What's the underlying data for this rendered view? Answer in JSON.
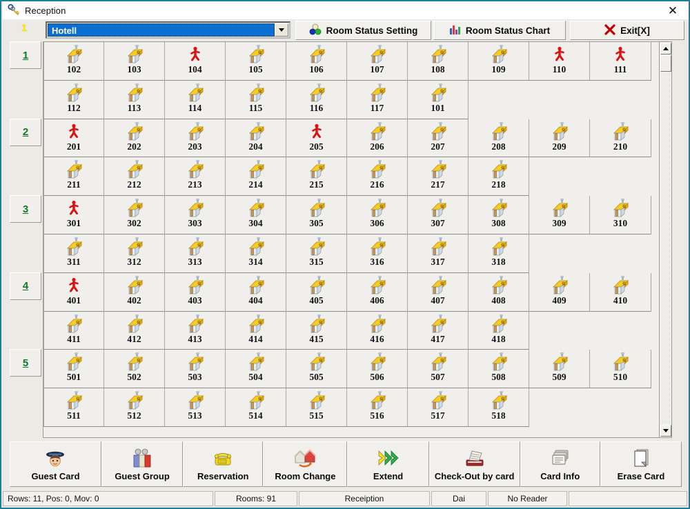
{
  "window": {
    "title": "Reception",
    "title_icon": "keys-icon",
    "close_label": "✕"
  },
  "toolbar": {
    "floor_indicator": "1",
    "combo": {
      "value": "Hotell",
      "arrow_icon": "chevron-down-icon"
    },
    "buttons": [
      {
        "label": "Room Status Setting",
        "icon": "three-circles-icon"
      },
      {
        "label": "Room Status Chart",
        "icon": "bar-chart-icon"
      },
      {
        "label": "Exit[X]",
        "icon": "red-x-icon"
      }
    ]
  },
  "floors": [
    {
      "label": "1"
    },
    {
      "label": "2"
    },
    {
      "label": "3"
    },
    {
      "label": "4"
    },
    {
      "label": "5"
    }
  ],
  "legend": {
    "vacant_icon": "house-icon",
    "occupied_icon": "red-person-icon"
  },
  "grid": {
    "columns": 10,
    "rows": [
      {
        "cells": [
          {
            "room": "102",
            "status": "vacant"
          },
          {
            "room": "103",
            "status": "vacant"
          },
          {
            "room": "104",
            "status": "occupied"
          },
          {
            "room": "105",
            "status": "vacant"
          },
          {
            "room": "106",
            "status": "vacant"
          },
          {
            "room": "107",
            "status": "vacant"
          },
          {
            "room": "108",
            "status": "vacant"
          },
          {
            "room": "109",
            "status": "vacant"
          },
          {
            "room": "110",
            "status": "occupied"
          },
          {
            "room": "111",
            "status": "occupied"
          }
        ]
      },
      {
        "cells": [
          {
            "room": "112",
            "status": "vacant"
          },
          {
            "room": "113",
            "status": "vacant"
          },
          {
            "room": "114",
            "status": "vacant"
          },
          {
            "room": "115",
            "status": "vacant"
          },
          {
            "room": "116",
            "status": "vacant"
          },
          {
            "room": "117",
            "status": "vacant"
          },
          {
            "room": "101",
            "status": "vacant"
          },
          {
            "room": "",
            "status": "empty"
          },
          {
            "room": "",
            "status": "empty"
          },
          {
            "room": "",
            "status": "empty"
          }
        ]
      },
      {
        "cells": [
          {
            "room": "201",
            "status": "occupied"
          },
          {
            "room": "202",
            "status": "vacant"
          },
          {
            "room": "203",
            "status": "vacant"
          },
          {
            "room": "204",
            "status": "vacant"
          },
          {
            "room": "205",
            "status": "occupied"
          },
          {
            "room": "206",
            "status": "vacant"
          },
          {
            "room": "207",
            "status": "vacant"
          },
          {
            "room": "208",
            "status": "vacant"
          },
          {
            "room": "209",
            "status": "vacant"
          },
          {
            "room": "210",
            "status": "vacant"
          }
        ]
      },
      {
        "cells": [
          {
            "room": "211",
            "status": "vacant"
          },
          {
            "room": "212",
            "status": "vacant"
          },
          {
            "room": "213",
            "status": "vacant"
          },
          {
            "room": "214",
            "status": "vacant"
          },
          {
            "room": "215",
            "status": "vacant"
          },
          {
            "room": "216",
            "status": "vacant"
          },
          {
            "room": "217",
            "status": "vacant"
          },
          {
            "room": "218",
            "status": "vacant"
          },
          {
            "room": "",
            "status": "empty"
          },
          {
            "room": "",
            "status": "empty"
          }
        ]
      },
      {
        "cells": [
          {
            "room": "301",
            "status": "occupied"
          },
          {
            "room": "302",
            "status": "vacant"
          },
          {
            "room": "303",
            "status": "vacant"
          },
          {
            "room": "304",
            "status": "vacant"
          },
          {
            "room": "305",
            "status": "vacant"
          },
          {
            "room": "306",
            "status": "vacant"
          },
          {
            "room": "307",
            "status": "vacant"
          },
          {
            "room": "308",
            "status": "vacant"
          },
          {
            "room": "309",
            "status": "vacant"
          },
          {
            "room": "310",
            "status": "vacant"
          }
        ]
      },
      {
        "cells": [
          {
            "room": "311",
            "status": "vacant"
          },
          {
            "room": "312",
            "status": "vacant"
          },
          {
            "room": "313",
            "status": "vacant"
          },
          {
            "room": "314",
            "status": "vacant"
          },
          {
            "room": "315",
            "status": "vacant"
          },
          {
            "room": "316",
            "status": "vacant"
          },
          {
            "room": "317",
            "status": "vacant"
          },
          {
            "room": "318",
            "status": "vacant"
          },
          {
            "room": "",
            "status": "empty"
          },
          {
            "room": "",
            "status": "empty"
          }
        ]
      },
      {
        "cells": [
          {
            "room": "401",
            "status": "occupied"
          },
          {
            "room": "402",
            "status": "vacant"
          },
          {
            "room": "403",
            "status": "vacant"
          },
          {
            "room": "404",
            "status": "vacant"
          },
          {
            "room": "405",
            "status": "vacant"
          },
          {
            "room": "406",
            "status": "vacant"
          },
          {
            "room": "407",
            "status": "vacant"
          },
          {
            "room": "408",
            "status": "vacant"
          },
          {
            "room": "409",
            "status": "vacant"
          },
          {
            "room": "410",
            "status": "vacant"
          }
        ]
      },
      {
        "cells": [
          {
            "room": "411",
            "status": "vacant"
          },
          {
            "room": "412",
            "status": "vacant"
          },
          {
            "room": "413",
            "status": "vacant"
          },
          {
            "room": "414",
            "status": "vacant"
          },
          {
            "room": "415",
            "status": "vacant"
          },
          {
            "room": "416",
            "status": "vacant"
          },
          {
            "room": "417",
            "status": "vacant"
          },
          {
            "room": "418",
            "status": "vacant"
          },
          {
            "room": "",
            "status": "empty"
          },
          {
            "room": "",
            "status": "empty"
          }
        ]
      },
      {
        "cells": [
          {
            "room": "501",
            "status": "vacant"
          },
          {
            "room": "502",
            "status": "vacant"
          },
          {
            "room": "503",
            "status": "vacant"
          },
          {
            "room": "504",
            "status": "vacant"
          },
          {
            "room": "505",
            "status": "vacant"
          },
          {
            "room": "506",
            "status": "vacant"
          },
          {
            "room": "507",
            "status": "vacant"
          },
          {
            "room": "508",
            "status": "vacant"
          },
          {
            "room": "509",
            "status": "vacant"
          },
          {
            "room": "510",
            "status": "vacant"
          }
        ]
      },
      {
        "cells": [
          {
            "room": "511",
            "status": "vacant"
          },
          {
            "room": "512",
            "status": "vacant"
          },
          {
            "room": "513",
            "status": "vacant"
          },
          {
            "room": "514",
            "status": "vacant"
          },
          {
            "room": "515",
            "status": "vacant"
          },
          {
            "room": "516",
            "status": "vacant"
          },
          {
            "room": "517",
            "status": "vacant"
          },
          {
            "room": "518",
            "status": "vacant"
          },
          {
            "room": "",
            "status": "empty"
          },
          {
            "room": "",
            "status": "empty"
          }
        ]
      }
    ]
  },
  "scrollbar": {
    "up_icon": "triangle-up-icon",
    "down_icon": "triangle-down-icon"
  },
  "actions": [
    {
      "label": "Guest Card",
      "icon": "guest-card-icon",
      "width": 135
    },
    {
      "label": "Guest Group",
      "icon": "guest-group-icon",
      "width": 120
    },
    {
      "label": "Reservation",
      "icon": "telephone-icon",
      "width": 118
    },
    {
      "label": "Room Change",
      "icon": "room-change-icon",
      "width": 124
    },
    {
      "label": "Extend",
      "icon": "extend-arrows-icon",
      "width": 120
    },
    {
      "label": "Check-Out by card",
      "icon": "card-reader-icon",
      "width": 134
    },
    {
      "label": "Card Info",
      "icon": "card-stack-icon",
      "width": 118
    },
    {
      "label": "Erase Card",
      "icon": "blank-card-icon",
      "width": 120
    }
  ],
  "statusbar": {
    "rows_info": "Rows: 11, Pos: 0, Mov: 0",
    "rooms": "Rooms:  91",
    "mode": "Receiption",
    "user": "Dai",
    "reader": "No Reader"
  },
  "colors": {
    "titlebar_bg": "#ffffff",
    "window_border": "#1d7f95",
    "face": "#f0efeb",
    "combo_highlight": "#0a6fd0",
    "floor_text": "#0d7a24",
    "occupied": "#dd1111",
    "roof": "#f5c518"
  }
}
